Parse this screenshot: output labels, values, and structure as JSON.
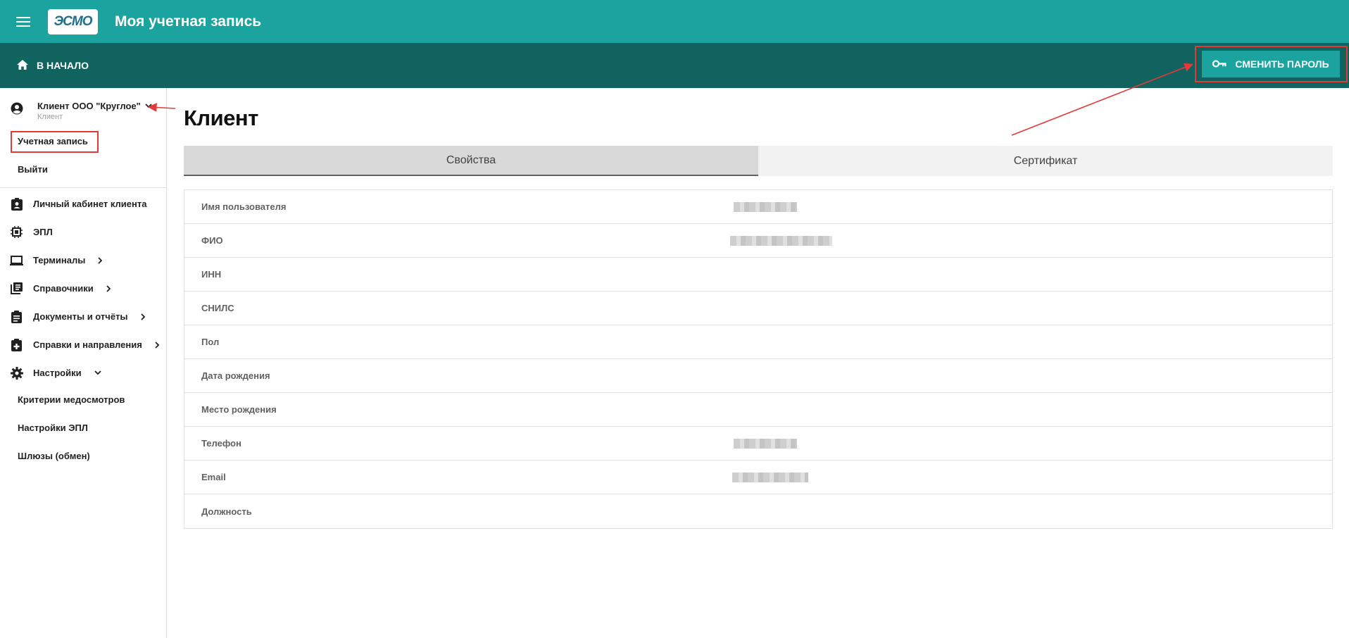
{
  "app": {
    "logo_text": "ЭСМО",
    "title": "Моя учетная запись"
  },
  "toolbar": {
    "home_label": "В НАЧАЛО",
    "change_password_label": "СМЕНИТЬ ПАРОЛЬ"
  },
  "sidebar": {
    "user": {
      "name": "Клиент ООО \"Круглое\"",
      "role": "Клиент"
    },
    "user_links": [
      {
        "label": "Учетная запись"
      },
      {
        "label": "Выйти"
      }
    ],
    "items": [
      {
        "label": "Личный кабинет клиента",
        "icon": "client-cabinet-icon"
      },
      {
        "label": "ЭПЛ",
        "icon": "chip-icon"
      },
      {
        "label": "Терминалы",
        "icon": "laptop-icon"
      },
      {
        "label": "Справочники",
        "icon": "library-icon"
      },
      {
        "label": "Документы и отчёты",
        "icon": "clipboard-icon"
      },
      {
        "label": "Справки и направления",
        "icon": "medical-bag-icon"
      },
      {
        "label": "Настройки",
        "icon": "gear-icon"
      }
    ],
    "settings_children": [
      {
        "label": "Критерии медосмотров"
      },
      {
        "label": "Настройки ЭПЛ"
      },
      {
        "label": "Шлюзы (обмен)"
      }
    ]
  },
  "main": {
    "title": "Клиент",
    "tabs": [
      {
        "label": "Свойства",
        "active": true
      },
      {
        "label": "Сертификат",
        "active": false
      }
    ],
    "properties": [
      {
        "label": "Имя пользователя",
        "value_blurred": true
      },
      {
        "label": "ФИО",
        "value_blurred": true
      },
      {
        "label": "ИНН",
        "value_blurred": false
      },
      {
        "label": "СНИЛС",
        "value_blurred": false
      },
      {
        "label": "Пол",
        "value_blurred": false
      },
      {
        "label": "Дата рождения",
        "value_blurred": false
      },
      {
        "label": "Место рождения",
        "value_blurred": false
      },
      {
        "label": "Телефон",
        "value_blurred": true
      },
      {
        "label": "Email",
        "value_blurred": true
      },
      {
        "label": "Должность",
        "value_blurred": false
      }
    ]
  },
  "colors": {
    "appbar": "#1ba3a0",
    "toolbar": "#116360",
    "annotation": "#e53935"
  }
}
